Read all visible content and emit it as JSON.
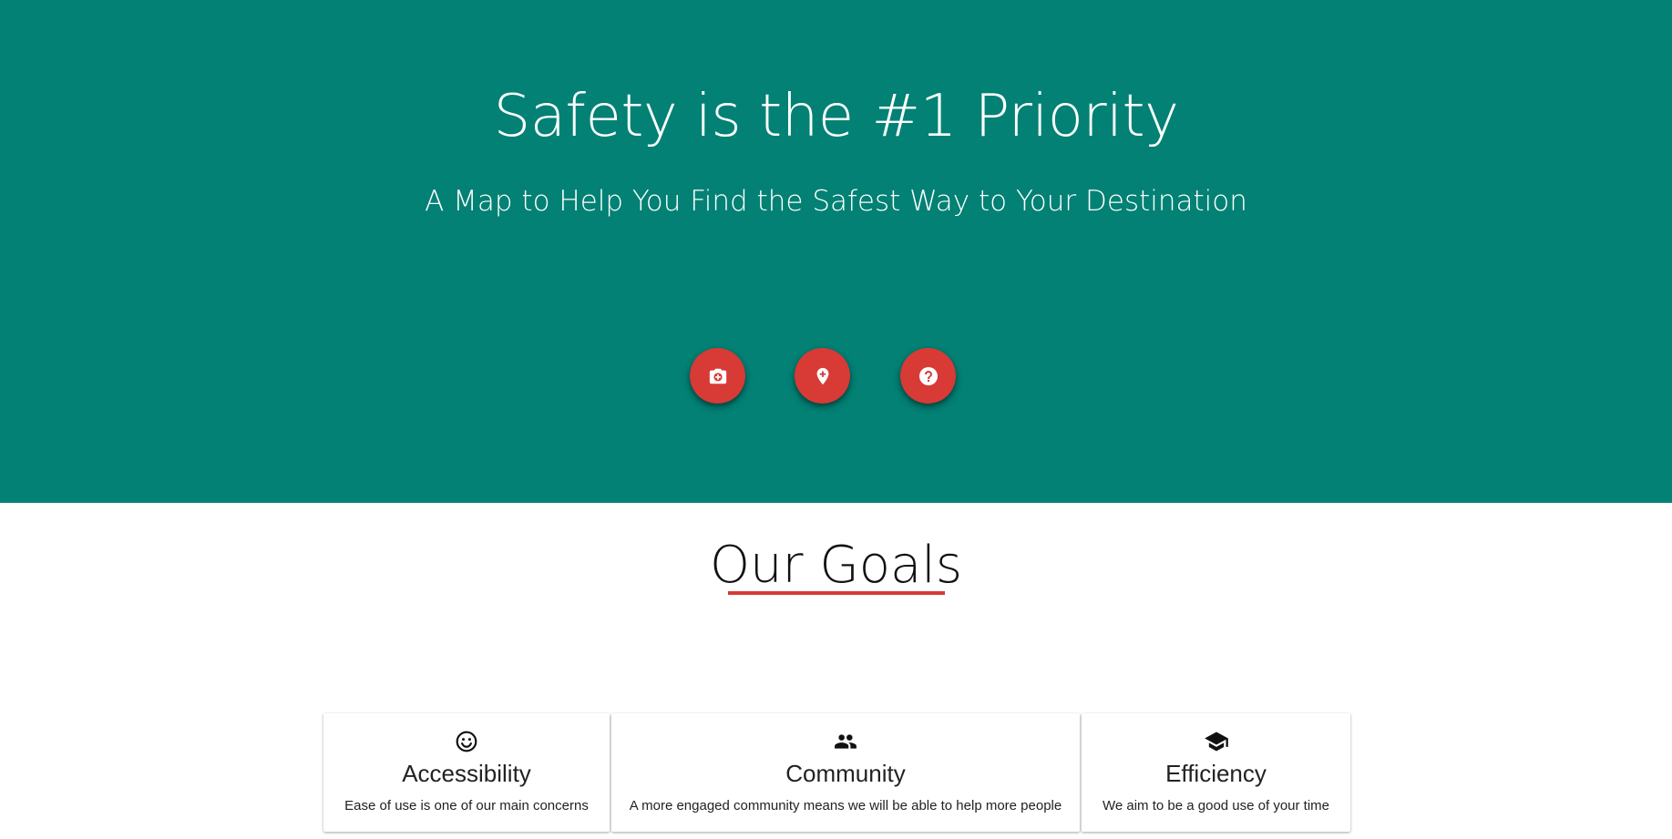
{
  "hero": {
    "title": "Safety is the #1 Priority",
    "subtitle": "A Map to Help You Find the Safest Way to Your Destination",
    "background_color": "#028174",
    "buttons": [
      {
        "icon": "add-a-photo-icon",
        "color": "#d83a36"
      },
      {
        "icon": "add-location-icon",
        "color": "#d83a36"
      },
      {
        "icon": "help-icon",
        "color": "#d83a36"
      }
    ]
  },
  "goals": {
    "heading": "Our Goals",
    "underline_color": "#d83a36",
    "cards": [
      {
        "icon": "smiley-face-icon",
        "title": "Accessibility",
        "text": "Ease of use is one of our main concerns"
      },
      {
        "icon": "people-icon",
        "title": "Community",
        "text": "A more engaged community means we will be able to help more people"
      },
      {
        "icon": "graduation-cap-icon",
        "title": "Efficiency",
        "text": "We aim to be a good use of your time"
      }
    ]
  }
}
